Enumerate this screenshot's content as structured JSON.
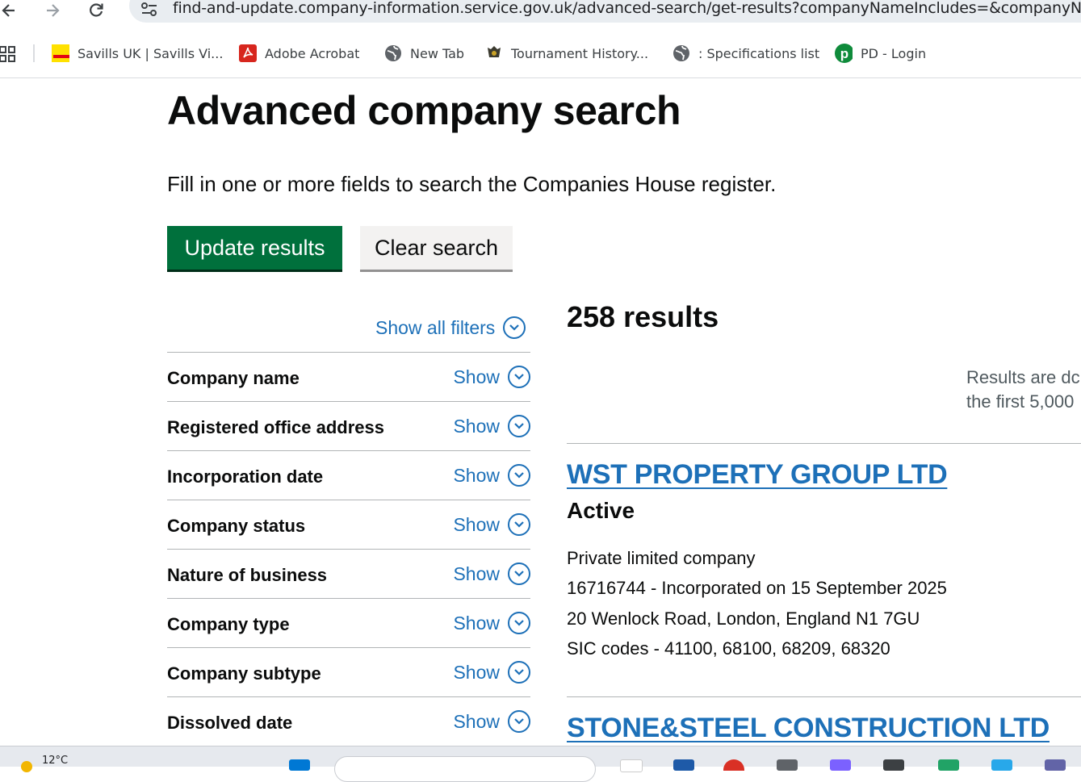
{
  "browser": {
    "url": "find-and-update.company-information.service.gov.uk/advanced-search/get-results?companyNameIncludes=&companyNa",
    "bookmarks": [
      {
        "label": "Savills UK | Savills Vi...",
        "icon": "savills-logo"
      },
      {
        "label": "Adobe Acrobat",
        "icon": "acrobat-icon"
      },
      {
        "label": "New Tab",
        "icon": "globe-icon"
      },
      {
        "label": "Tournament History...",
        "icon": "tournament-icon"
      },
      {
        "label": ": Specifications list",
        "icon": "globe-icon"
      },
      {
        "label": "PD - Login",
        "icon": "pd-icon"
      }
    ]
  },
  "page": {
    "title": "Advanced company search",
    "lead": "Fill in one or more fields to search the Companies House register.",
    "update_button": "Update results",
    "clear_button": "Clear search"
  },
  "filters": {
    "show_all": "Show all filters",
    "show_label": "Show",
    "items": [
      "Company name",
      "Registered office address",
      "Incorporation date",
      "Company status",
      "Nature of business",
      "Company type",
      "Company subtype",
      "Dissolved date"
    ]
  },
  "results": {
    "count": "258 results",
    "note_line1": "Results are dc",
    "note_line2": "the first 5,000",
    "items": [
      {
        "name": "WST PROPERTY GROUP LTD",
        "status": "Active",
        "type": "Private limited company",
        "incorporation": "16716744 - Incorporated on 15 September 2025",
        "address": "20 Wenlock Road, London, England N1 7GU",
        "sic": "SIC codes - 41100, 68100, 68209, 68320"
      },
      {
        "name": "STONE&STEEL CONSTRUCTION LTD"
      }
    ]
  },
  "taskbar": {
    "weather": "12°C"
  },
  "colors": {
    "link": "#1d70b8",
    "primary_button": "#00703c",
    "text": "#0b0c0c",
    "divider": "#b1b4b6"
  }
}
